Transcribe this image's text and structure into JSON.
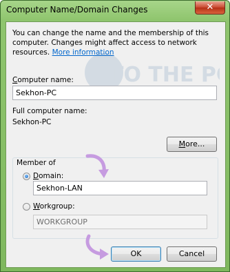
{
  "window": {
    "title": "Computer Name/Domain Changes",
    "close_glyph": "✕"
  },
  "intro": {
    "text": "You can change the name and the membership of this computer. Changes might affect access to network resources.",
    "link": "More information"
  },
  "computer_name": {
    "label_underlined": "C",
    "label_rest": "omputer name:",
    "value": "Sekhon-PC"
  },
  "full_name": {
    "label": "Full computer name:",
    "value": "Sekhon-PC"
  },
  "more_button": {
    "label_underlined": "M",
    "label_rest": "ore..."
  },
  "member_of": {
    "label": "Member of",
    "domain": {
      "label_underlined": "D",
      "label_rest": "omain:",
      "value": "Sekhon-LAN",
      "selected": true
    },
    "workgroup": {
      "label_underlined": "W",
      "label_rest": "orkgroup:",
      "value": "WORKGROUP",
      "selected": false
    }
  },
  "buttons": {
    "ok": "OK",
    "cancel": "Cancel"
  },
  "watermark_text": "TO THE PC",
  "colors": {
    "frame_accent": "#8fc56e",
    "close_red": "#c9462d",
    "link_blue": "#0066cc",
    "annotation_arrow": "#c69be0"
  }
}
